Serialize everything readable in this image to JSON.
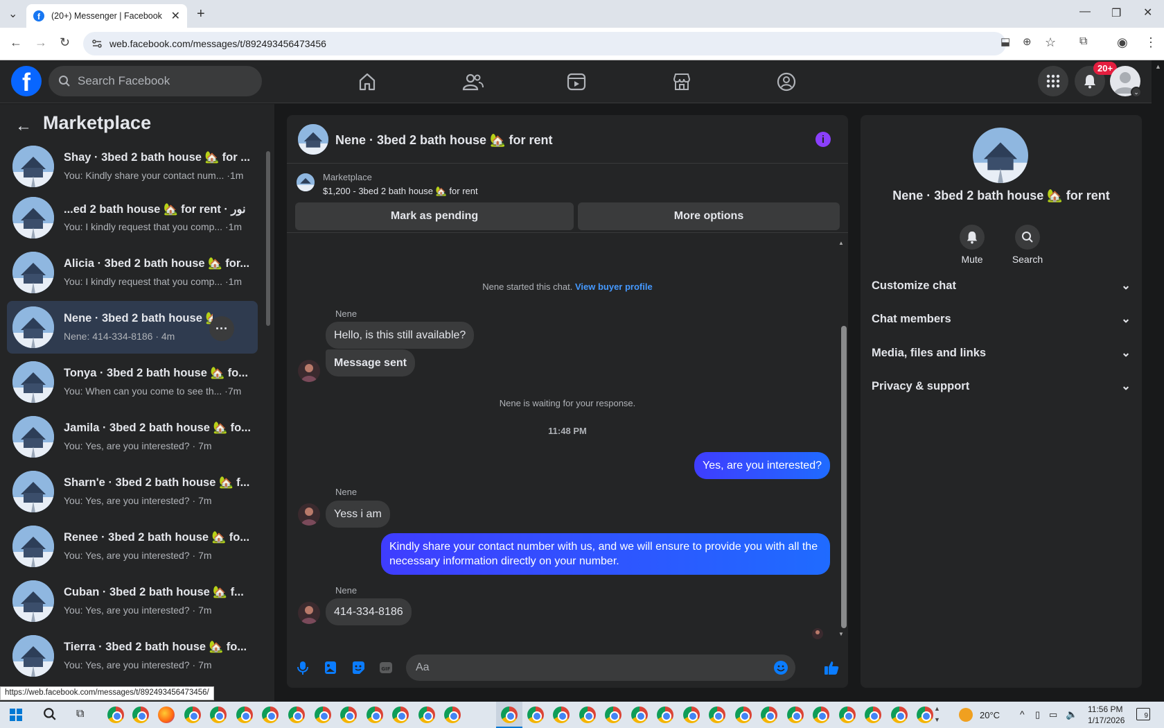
{
  "browser": {
    "tab_title": "(20+) Messenger | Facebook",
    "url": "web.facebook.com/messages/t/892493456473456",
    "status_url": "https://web.facebook.com/messages/t/892493456473456/"
  },
  "fb": {
    "logo": "f",
    "search_placeholder": "Search Facebook",
    "notif_badge": "20+"
  },
  "sidebar": {
    "title": "Marketplace",
    "conversations": [
      {
        "name": "Shay · 3bed 2 bath house 🏡 for ...",
        "preview": "You: Kindly share your contact num... ·1m"
      },
      {
        "name": "...ed 2 bath house 🏡 for rent · نور",
        "preview": "You: I kindly request that you comp... ·1m"
      },
      {
        "name": "Alicia · 3bed 2 bath house 🏡 for...",
        "preview": "You: I kindly request that you comp... ·1m"
      },
      {
        "name": "Nene · 3bed 2 bath house 🏡 for...",
        "preview": "Nene: 414-334-8186 · 4m"
      },
      {
        "name": "Tonya · 3bed 2 bath house 🏡 fo...",
        "preview": "You: When can you come to see th... ·7m"
      },
      {
        "name": "Jamila · 3bed 2 bath house 🏡 fo...",
        "preview": "You: Yes, are you interested? · 7m"
      },
      {
        "name": "Sharn'e · 3bed 2 bath house 🏡 f...",
        "preview": "You: Yes, are you interested? · 7m"
      },
      {
        "name": "Renee · 3bed 2 bath house 🏡 fo...",
        "preview": "You: Yes, are you interested? · 7m"
      },
      {
        "name": "Cuban · 3bed 2 bath house 🏡 f...",
        "preview": "You: Yes, are you interested? · 7m"
      },
      {
        "name": "Tierra · 3bed 2 bath house 🏡 fo...",
        "preview": "You: Yes, are you interested? · 7m"
      }
    ]
  },
  "chat": {
    "title": "Nene · 3bed 2 bath house 🏡 for rent",
    "marketplace_label": "Marketplace",
    "listing": "$1,200 - 3bed 2 bath house 🏡 for rent",
    "btn_pending": "Mark as pending",
    "btn_more": "More options",
    "started": "Nene started this chat.",
    "view_profile": "View buyer profile",
    "sender": "Nene",
    "msg1": "Hello, is this still available?",
    "msg2": "Message sent",
    "waiting": "Nene is waiting for your response.",
    "time": "11:48 PM",
    "out1": "Yes, are you interested?",
    "msg3": "Yess i am",
    "out2": "Kindly share your contact number with us, and we will ensure to provide you with all the necessary information directly on your number.",
    "msg4": "414-334-8186",
    "composer_placeholder": "Aa"
  },
  "details": {
    "title": "Nene · 3bed 2 bath house 🏡 for rent",
    "mute": "Mute",
    "search": "Search",
    "sections": [
      "Customize chat",
      "Chat members",
      "Media, files and links",
      "Privacy & support"
    ]
  },
  "taskbar": {
    "weather": "20°C",
    "time": "11:56 PM",
    "date": "1/17/2026",
    "notif_count": "9"
  }
}
